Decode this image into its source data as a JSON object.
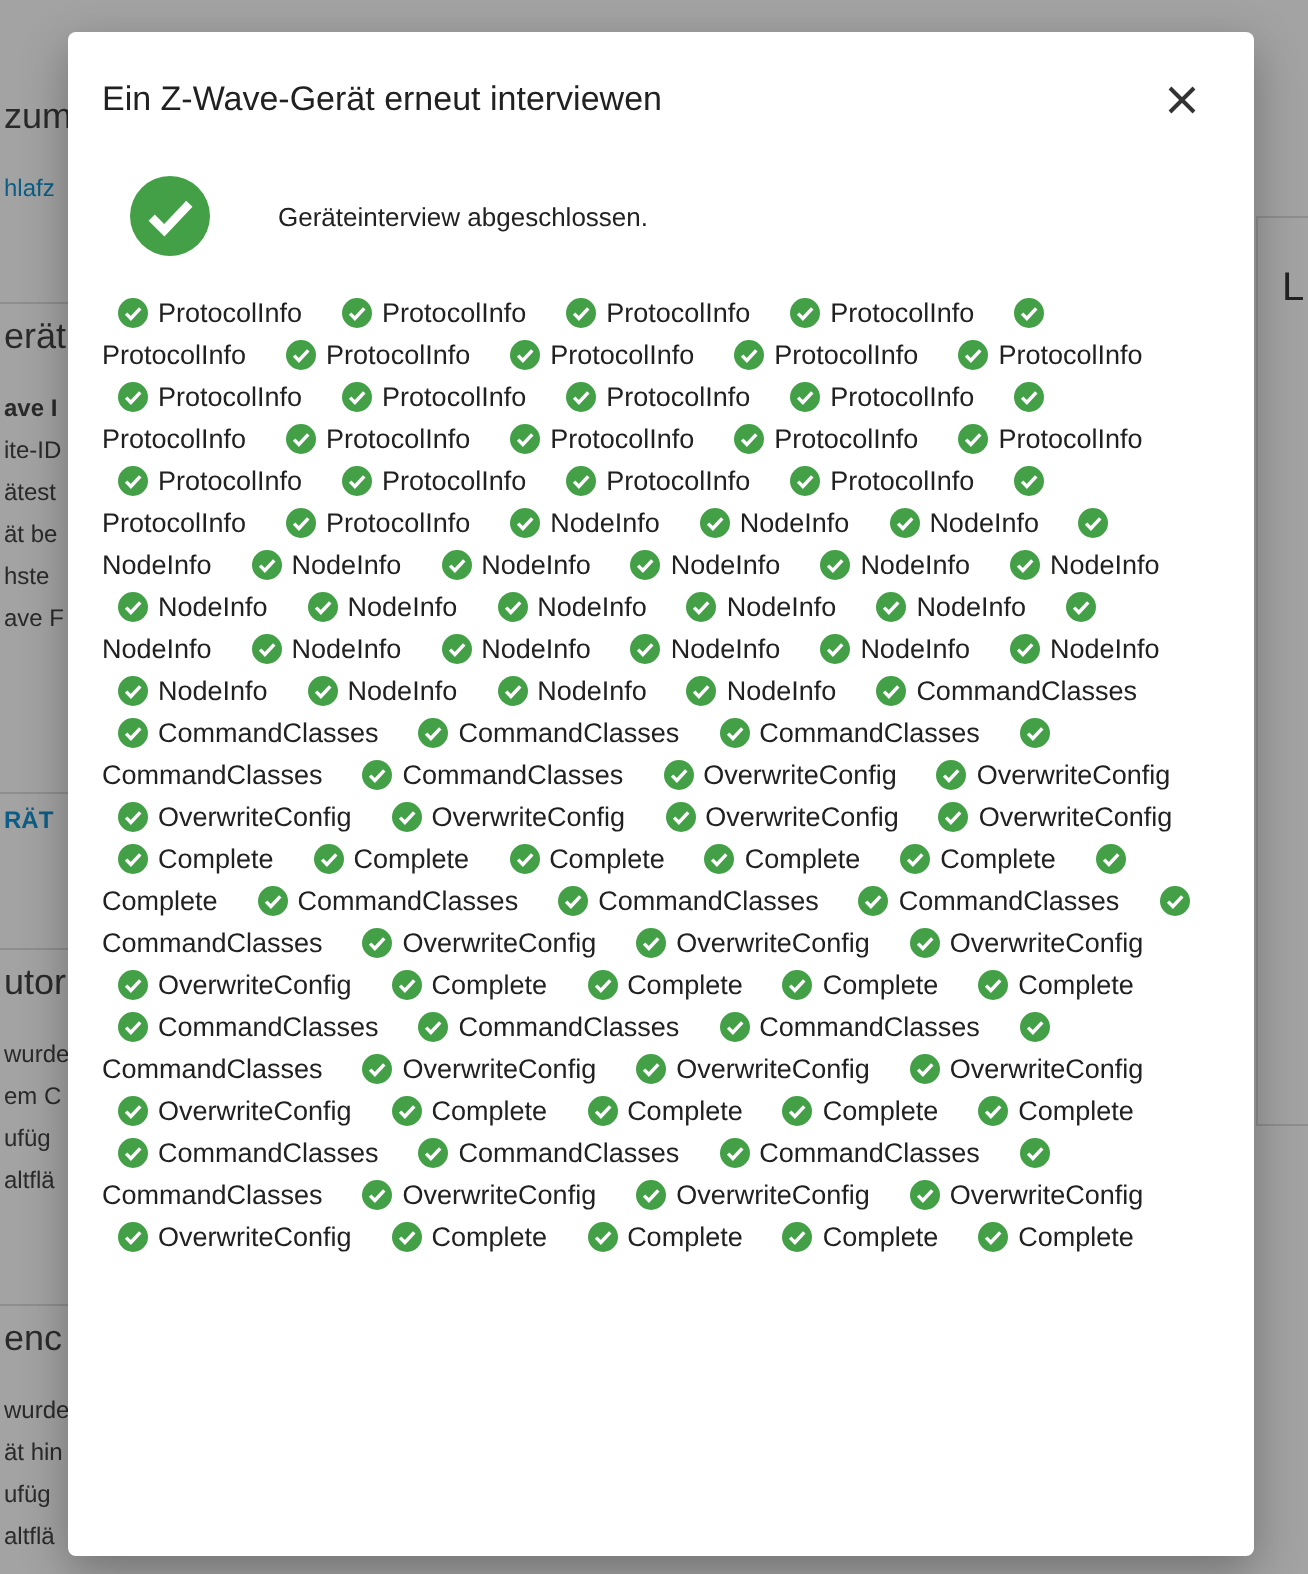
{
  "background": {
    "left_sections": [
      {
        "lines": [
          {
            "kind": "heading",
            "text": "zum"
          },
          {
            "kind": "link",
            "text": "hlafz"
          }
        ]
      },
      {
        "lines": [
          {
            "kind": "heading",
            "text": "erät"
          },
          {
            "kind": "bold",
            "text": "ave I"
          },
          {
            "kind": "text",
            "text": "ite-ID"
          },
          {
            "kind": "text",
            "text": "ätest"
          },
          {
            "kind": "text",
            "text": "ät be"
          },
          {
            "kind": "text",
            "text": "hste"
          },
          {
            "kind": "text",
            "text": "ave F"
          }
        ]
      },
      {
        "lines": [
          {
            "kind": "button",
            "text": "RÄT"
          }
        ]
      },
      {
        "lines": [
          {
            "kind": "heading",
            "text": "utor"
          },
          {
            "kind": "text",
            "text": "wurde"
          },
          {
            "kind": "text",
            "text": "em C"
          },
          {
            "kind": "text",
            "text": "ufüg"
          },
          {
            "kind": "text",
            "text": "altflä"
          }
        ]
      },
      {
        "lines": [
          {
            "kind": "heading",
            "text": "enc"
          },
          {
            "kind": "text",
            "text": "wurde"
          },
          {
            "kind": "text",
            "text": "ät hin"
          },
          {
            "kind": "text",
            "text": "ufüg"
          },
          {
            "kind": "text",
            "text": "altflä"
          }
        ]
      }
    ],
    "right_heading": "L"
  },
  "dialog": {
    "title": "Ein Z-Wave-Gerät erneut interviewen",
    "status": {
      "text": "Geräteinterview abgeschlossen.",
      "success": true
    },
    "stages": [
      {
        "name": "ProtocolInfo",
        "done": true
      },
      {
        "name": "ProtocolInfo",
        "done": true
      },
      {
        "name": "ProtocolInfo",
        "done": true
      },
      {
        "name": "ProtocolInfo",
        "done": true
      },
      {
        "name": "ProtocolInfo",
        "done": true
      },
      {
        "name": "ProtocolInfo",
        "done": true
      },
      {
        "name": "ProtocolInfo",
        "done": true
      },
      {
        "name": "ProtocolInfo",
        "done": true
      },
      {
        "name": "ProtocolInfo",
        "done": true
      },
      {
        "name": "ProtocolInfo",
        "done": true
      },
      {
        "name": "ProtocolInfo",
        "done": true
      },
      {
        "name": "ProtocolInfo",
        "done": true
      },
      {
        "name": "ProtocolInfo",
        "done": true
      },
      {
        "name": "ProtocolInfo",
        "done": true
      },
      {
        "name": "ProtocolInfo",
        "done": true
      },
      {
        "name": "ProtocolInfo",
        "done": true
      },
      {
        "name": "ProtocolInfo",
        "done": true
      },
      {
        "name": "ProtocolInfo",
        "done": true
      },
      {
        "name": "ProtocolInfo",
        "done": true
      },
      {
        "name": "ProtocolInfo",
        "done": true
      },
      {
        "name": "ProtocolInfo",
        "done": true
      },
      {
        "name": "ProtocolInfo",
        "done": true
      },
      {
        "name": "ProtocolInfo",
        "done": true
      },
      {
        "name": "ProtocolInfo",
        "done": true
      },
      {
        "name": "NodeInfo",
        "done": true
      },
      {
        "name": "NodeInfo",
        "done": true
      },
      {
        "name": "NodeInfo",
        "done": true
      },
      {
        "name": "NodeInfo",
        "done": true
      },
      {
        "name": "NodeInfo",
        "done": true
      },
      {
        "name": "NodeInfo",
        "done": true
      },
      {
        "name": "NodeInfo",
        "done": true
      },
      {
        "name": "NodeInfo",
        "done": true
      },
      {
        "name": "NodeInfo",
        "done": true
      },
      {
        "name": "NodeInfo",
        "done": true
      },
      {
        "name": "NodeInfo",
        "done": true
      },
      {
        "name": "NodeInfo",
        "done": true
      },
      {
        "name": "NodeInfo",
        "done": true
      },
      {
        "name": "NodeInfo",
        "done": true
      },
      {
        "name": "NodeInfo",
        "done": true
      },
      {
        "name": "NodeInfo",
        "done": true
      },
      {
        "name": "NodeInfo",
        "done": true
      },
      {
        "name": "NodeInfo",
        "done": true
      },
      {
        "name": "NodeInfo",
        "done": true
      },
      {
        "name": "NodeInfo",
        "done": true
      },
      {
        "name": "NodeInfo",
        "done": true
      },
      {
        "name": "NodeInfo",
        "done": true
      },
      {
        "name": "NodeInfo",
        "done": true
      },
      {
        "name": "NodeInfo",
        "done": true
      },
      {
        "name": "CommandClasses",
        "done": true
      },
      {
        "name": "CommandClasses",
        "done": true
      },
      {
        "name": "CommandClasses",
        "done": true
      },
      {
        "name": "CommandClasses",
        "done": true
      },
      {
        "name": "CommandClasses",
        "done": true
      },
      {
        "name": "CommandClasses",
        "done": true
      },
      {
        "name": "OverwriteConfig",
        "done": true
      },
      {
        "name": "OverwriteConfig",
        "done": true
      },
      {
        "name": "OverwriteConfig",
        "done": true
      },
      {
        "name": "OverwriteConfig",
        "done": true
      },
      {
        "name": "OverwriteConfig",
        "done": true
      },
      {
        "name": "OverwriteConfig",
        "done": true
      },
      {
        "name": "Complete",
        "done": true
      },
      {
        "name": "Complete",
        "done": true
      },
      {
        "name": "Complete",
        "done": true
      },
      {
        "name": "Complete",
        "done": true
      },
      {
        "name": "Complete",
        "done": true
      },
      {
        "name": "Complete",
        "done": true
      },
      {
        "name": "CommandClasses",
        "done": true
      },
      {
        "name": "CommandClasses",
        "done": true
      },
      {
        "name": "CommandClasses",
        "done": true
      },
      {
        "name": "CommandClasses",
        "done": true
      },
      {
        "name": "OverwriteConfig",
        "done": true
      },
      {
        "name": "OverwriteConfig",
        "done": true
      },
      {
        "name": "OverwriteConfig",
        "done": true
      },
      {
        "name": "OverwriteConfig",
        "done": true
      },
      {
        "name": "Complete",
        "done": true
      },
      {
        "name": "Complete",
        "done": true
      },
      {
        "name": "Complete",
        "done": true
      },
      {
        "name": "Complete",
        "done": true
      },
      {
        "name": "CommandClasses",
        "done": true
      },
      {
        "name": "CommandClasses",
        "done": true
      },
      {
        "name": "CommandClasses",
        "done": true
      },
      {
        "name": "CommandClasses",
        "done": true
      },
      {
        "name": "OverwriteConfig",
        "done": true
      },
      {
        "name": "OverwriteConfig",
        "done": true
      },
      {
        "name": "OverwriteConfig",
        "done": true
      },
      {
        "name": "OverwriteConfig",
        "done": true
      },
      {
        "name": "Complete",
        "done": true
      },
      {
        "name": "Complete",
        "done": true
      },
      {
        "name": "Complete",
        "done": true
      },
      {
        "name": "Complete",
        "done": true
      },
      {
        "name": "CommandClasses",
        "done": true
      },
      {
        "name": "CommandClasses",
        "done": true
      },
      {
        "name": "CommandClasses",
        "done": true
      },
      {
        "name": "CommandClasses",
        "done": true
      },
      {
        "name": "OverwriteConfig",
        "done": true
      },
      {
        "name": "OverwriteConfig",
        "done": true
      },
      {
        "name": "OverwriteConfig",
        "done": true
      },
      {
        "name": "OverwriteConfig",
        "done": true
      },
      {
        "name": "Complete",
        "done": true
      },
      {
        "name": "Complete",
        "done": true
      },
      {
        "name": "Complete",
        "done": true
      },
      {
        "name": "Complete",
        "done": true
      }
    ]
  }
}
